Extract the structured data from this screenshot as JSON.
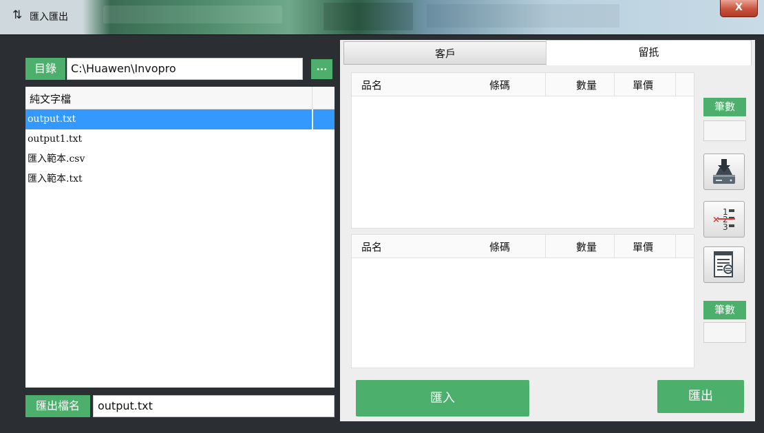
{
  "window": {
    "title": "匯入匯出",
    "app_icon": "refresh-arrows-icon",
    "close_label": "X"
  },
  "left": {
    "directory_label": "目錄",
    "directory_value": "C:\\Huawen\\Invopro",
    "browse_label": "...",
    "list_header": "純文字檔",
    "files": [
      {
        "name": "output.txt",
        "selected": true
      },
      {
        "name": "output1.txt",
        "selected": false
      },
      {
        "name": "匯入範本.csv",
        "selected": false
      },
      {
        "name": "匯入範本.txt",
        "selected": false
      }
    ],
    "export_name_label": "匯出檔名",
    "export_name_value": "output.txt"
  },
  "right": {
    "tabs": [
      {
        "label": "客戶",
        "active": false
      },
      {
        "label": "留扺",
        "active": true
      }
    ],
    "columns": [
      "品名",
      "條碼",
      "數量",
      "單價"
    ],
    "count_label": "筆數",
    "icons": [
      "save-to-drive-icon",
      "delete-numbered-list-icon",
      "document-list-icon"
    ],
    "import_label": "匯入",
    "export_label": "匯出"
  },
  "colors": {
    "accent_green": "#4caf6c",
    "selection_blue": "#3399ff",
    "close_red": "#c9523c"
  }
}
